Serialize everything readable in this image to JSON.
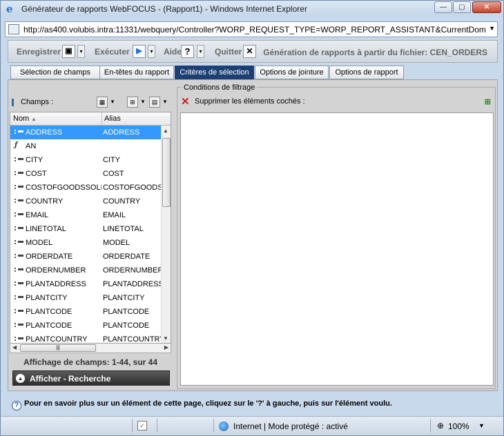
{
  "window": {
    "title": "Générateur de rapports WebFOCUS - (Rapport1) - Windows Internet Explorer",
    "min": "—",
    "max": "▢",
    "close": "✕"
  },
  "address": {
    "url": "http://as400.volubis.intra:11331/webquery/Controller?WORP_REQUEST_TYPE=WORP_REPORT_ASSISTANT&CurrentDomain=u"
  },
  "toolbar": {
    "save": "Enregistrer",
    "run": "Exécuter",
    "help": "Aide",
    "help_symbol": "?",
    "quit": "Quitter",
    "quit_symbol": "✕",
    "title": "Génération de rapports à partir du fichier: CEN_ORDERS"
  },
  "tabs": [
    "Sélection de champs",
    "En-têtes du rapport",
    "Critères de sélection",
    "Options de jointure",
    "Options de rapport"
  ],
  "active_tab": 2,
  "fields": {
    "label": "Champs :",
    "col_name": "Nom",
    "col_alias": "Alias",
    "rows": [
      {
        "name": "ADDRESS",
        "alias": "ADDRESS",
        "icon": "field-icon"
      },
      {
        "name": "AN",
        "alias": "",
        "icon": "computed-field-icon"
      },
      {
        "name": "CITY",
        "alias": "CITY",
        "icon": "field-icon"
      },
      {
        "name": "COST",
        "alias": "COST",
        "icon": "field-icon"
      },
      {
        "name": "COSTOFGOODSSOLD",
        "alias": "COSTOFGOODSSOLD",
        "icon": "field-icon"
      },
      {
        "name": "COUNTRY",
        "alias": "COUNTRY",
        "icon": "field-icon"
      },
      {
        "name": "EMAIL",
        "alias": "EMAIL",
        "icon": "field-icon"
      },
      {
        "name": "LINETOTAL",
        "alias": "LINETOTAL",
        "icon": "field-icon"
      },
      {
        "name": "MODEL",
        "alias": "MODEL",
        "icon": "field-icon"
      },
      {
        "name": "ORDERDATE",
        "alias": "ORDERDATE",
        "icon": "field-icon"
      },
      {
        "name": "ORDERNUMBER",
        "alias": "ORDERNUMBER",
        "icon": "field-icon"
      },
      {
        "name": "PLANTADDRESS",
        "alias": "PLANTADDRESS",
        "icon": "field-icon"
      },
      {
        "name": "PLANTCITY",
        "alias": "PLANTCITY",
        "icon": "field-icon"
      },
      {
        "name": "PLANTCODE",
        "alias": "PLANTCODE",
        "icon": "field-icon"
      },
      {
        "name": "PLANTCODE",
        "alias": "PLANTCODE",
        "icon": "field-icon"
      },
      {
        "name": "PLANTCOUNTRY",
        "alias": "PLANTCOUNTRY",
        "icon": "field-icon"
      }
    ],
    "selected_row": 0,
    "count": "Affichage de champs: 1-44, sur 44",
    "search": "Afficher - Recherche"
  },
  "filter": {
    "legend": "Conditions de filtrage",
    "delete": "Supprimer les éléments cochés :"
  },
  "help_text": "Pour en savoir plus sur un élément de cette page, cliquez sur le '?' à gauche, puis sur l'élément voulu.",
  "status": {
    "zone": "Internet | Mode protégé : activé",
    "zoom": "100%"
  },
  "colors": {
    "active_tab": "#1e3f73",
    "selection": "#3399ff",
    "delete": "#d02020"
  }
}
